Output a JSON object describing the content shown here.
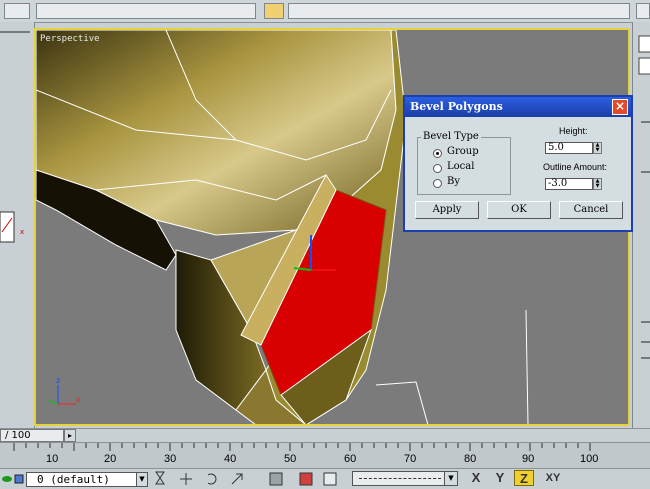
{
  "viewport": {
    "label": "Perspective"
  },
  "dialog": {
    "title": "Bevel Polygons",
    "group_label": "Bevel Type",
    "options": [
      "Group",
      "Local",
      "By"
    ],
    "selected": "Group",
    "height_label": "Height:",
    "height_value": "5.0",
    "outline_label": "Outline Amount:",
    "outline_value": "-3.0",
    "apply": "Apply",
    "ok": "OK",
    "cancel": "Cancel",
    "close": "×"
  },
  "timeline": {
    "frame": "/ 100",
    "ticks": [
      "10",
      "20",
      "30",
      "40",
      "50",
      "60",
      "70",
      "80",
      "90",
      "100"
    ]
  },
  "status": {
    "layer": "0 (default)",
    "axes": [
      "X",
      "Y",
      "Z",
      "XY"
    ]
  },
  "colors": {
    "selection": "#d80000",
    "mesh": "#9a8a30",
    "viewport_border": "#e6d23c",
    "active_axis": "#f0d030"
  }
}
